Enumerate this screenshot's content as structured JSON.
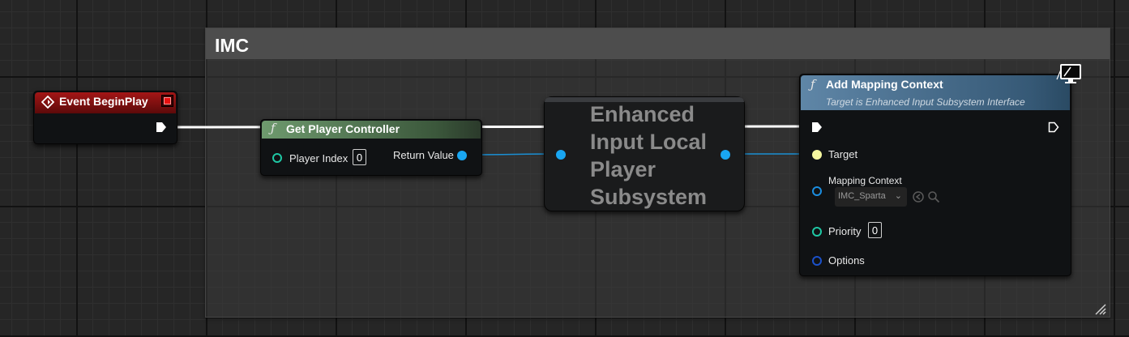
{
  "comment": {
    "title": "IMC"
  },
  "event_node": {
    "title": "Event BeginPlay",
    "icon": "event-diamond-icon"
  },
  "get_player_controller": {
    "title": "Get Player Controller",
    "icon_glyph": "ƒ",
    "player_index_label": "Player Index",
    "player_index_value": "0",
    "return_value_label": "Return Value"
  },
  "subsystem_node": {
    "title": "Enhanced Input Local Player Subsystem"
  },
  "add_mapping_context": {
    "title": "Add Mapping Context",
    "icon_glyph": "ƒ",
    "subtitle": "Target is Enhanced Input Subsystem Interface",
    "target_label": "Target",
    "mapping_context_label": "Mapping Context",
    "mapping_context_value": "IMC_Sparta",
    "priority_label": "Priority",
    "priority_value": "0",
    "options_label": "Options",
    "corner_icon": "monitor-icon"
  },
  "colors": {
    "event_header": "#a41616",
    "pure_header": "#6e9a6e",
    "function_header": "#5f86a7",
    "object_pin": "#19a6f2",
    "int_pin": "#1fc7a4",
    "exec_wire": "#ffffff"
  }
}
